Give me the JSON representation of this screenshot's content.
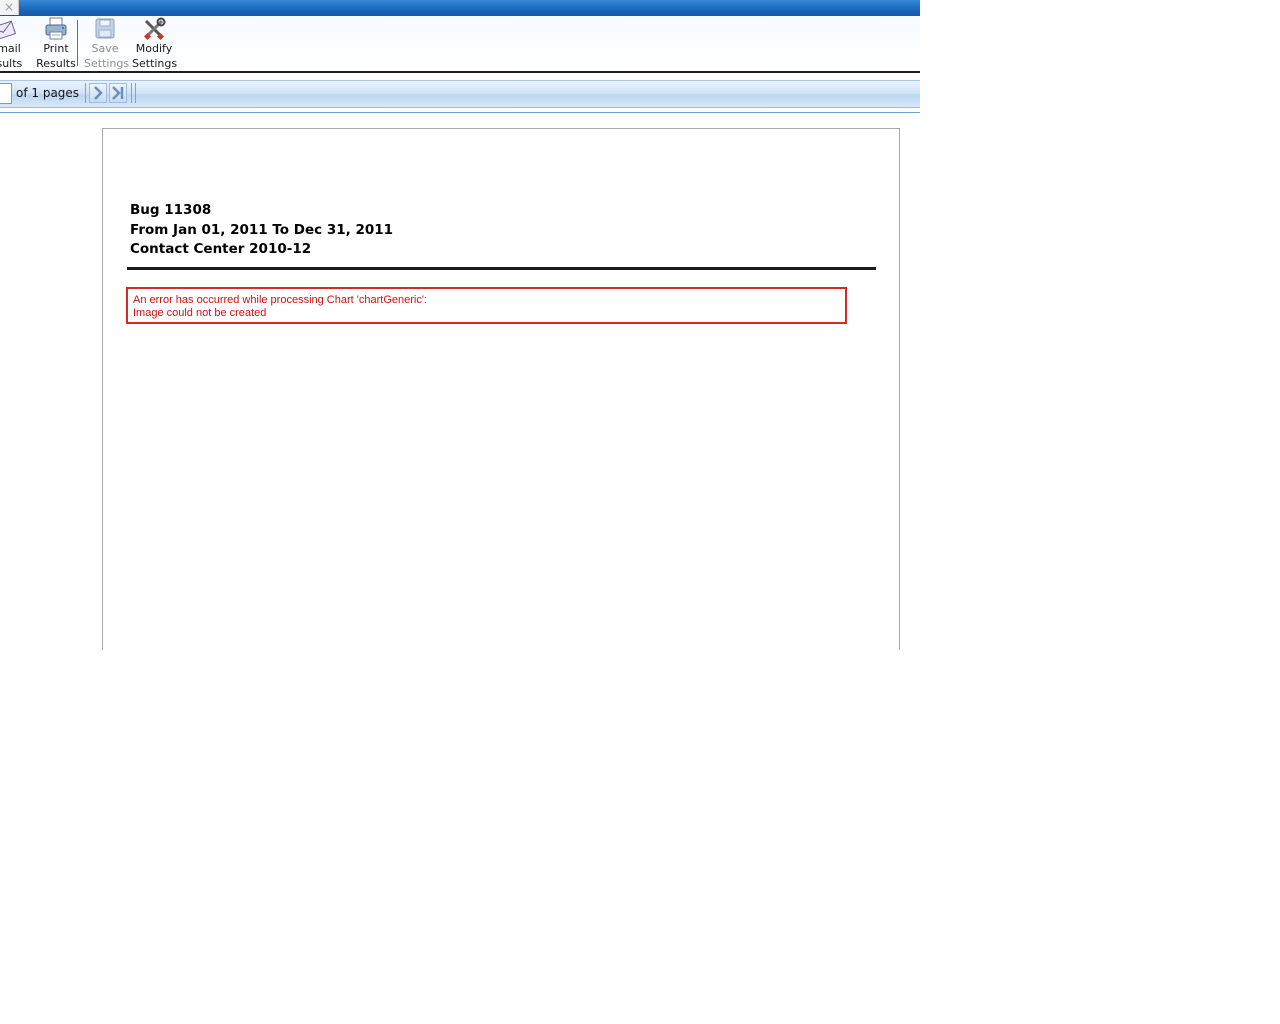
{
  "titlebar": {
    "close_glyph": "×"
  },
  "toolbar": {
    "email": {
      "line1": "mail",
      "line2": "esults",
      "icon": "envelope-icon"
    },
    "print": {
      "line1": "Print",
      "line2": "Results",
      "icon": "printer-icon"
    },
    "save": {
      "line1": "Save",
      "line2": "Settings",
      "icon": "floppy-disk-icon",
      "disabled": true
    },
    "modify": {
      "line1": "Modify",
      "line2": "Settings",
      "icon": "tools-icon"
    }
  },
  "pager": {
    "page_value": "",
    "of_pages": "of 1 pages",
    "next_icon": "chevron-right-icon",
    "last_icon": "last-page-icon"
  },
  "report": {
    "title": "Bug 11308",
    "date_range": "From Jan 01, 2011 To Dec 31, 2011",
    "subtitle": "Contact Center 2010-12",
    "error_line1": "An error has occurred while processing Chart 'chartGeneric':",
    "error_line2": "Image could not be created"
  },
  "colors": {
    "titlebar": "#1a66b9",
    "error": "#cc1111"
  }
}
